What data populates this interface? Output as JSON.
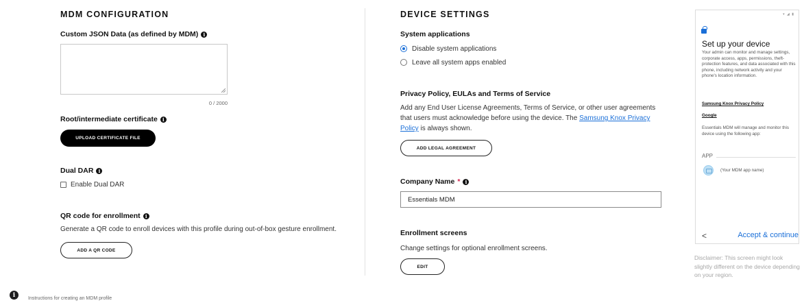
{
  "mdm": {
    "section_title": "MDM CONFIGURATION",
    "json_label": "Custom JSON Data (as defined by MDM)",
    "json_value": "",
    "json_counter": "0 / 2000",
    "cert_label": "Root/intermediate certificate",
    "cert_button": "UPLOAD CERTIFICATE FILE",
    "dual_dar_label": "Dual DAR",
    "dual_dar_checkbox": "Enable Dual DAR",
    "dual_dar_checked": false,
    "qr_label": "QR code for enrollment",
    "qr_description": "Generate a QR code to enroll devices with this profile during out-of-box gesture enrollment.",
    "qr_button": "ADD A QR CODE"
  },
  "device": {
    "section_title": "DEVICE SETTINGS",
    "sys_apps_label": "System applications",
    "sys_apps_options": [
      {
        "label": "Disable system applications",
        "selected": true
      },
      {
        "label": "Leave all system apps enabled",
        "selected": false
      }
    ],
    "privacy_label": "Privacy Policy, EULAs and Terms of Service",
    "privacy_text_1": "Add any End User License Agreements, Terms of Service, or other user agreements that users must acknowledge before using the device. The",
    "privacy_link": "Samsung Knox Privacy Policy",
    "privacy_text_2": "is always shown.",
    "legal_button": "ADD LEGAL AGREEMENT",
    "company_label": "Company Name",
    "company_required_mark": "*",
    "company_value": "Essentials MDM",
    "enrollment_label": "Enrollment screens",
    "enrollment_description": "Change settings for optional enrollment screens.",
    "edit_button": "EDIT"
  },
  "preview": {
    "status_icons": "▾ ◢ ▮",
    "title": "Set up your device",
    "description": "Your admin can monitor and manage settings, corporate access, apps, permissions, theft-protection features, and data associated with this phone, including network activity and your phone's location information.",
    "link_knox": "Samsung Knox Privacy Policy",
    "link_google": "Google",
    "manage_text": "Essentials MDM will manage and monitor this device using the following app:",
    "app_label": "APP",
    "app_name": "(Your MDM app name)",
    "back": "<",
    "accept": "Accept & continue",
    "disclaimer": "Disclaimer: This screen might look slightly different on the device depending on your region."
  },
  "footer": {
    "info_glyph": "i",
    "text": "Instructions for creating an MDM profile"
  },
  "icons": {
    "info": "i"
  },
  "colors": {
    "accent": "#1a6fd8",
    "required": "#d3244d",
    "primary_button": "#000000"
  }
}
